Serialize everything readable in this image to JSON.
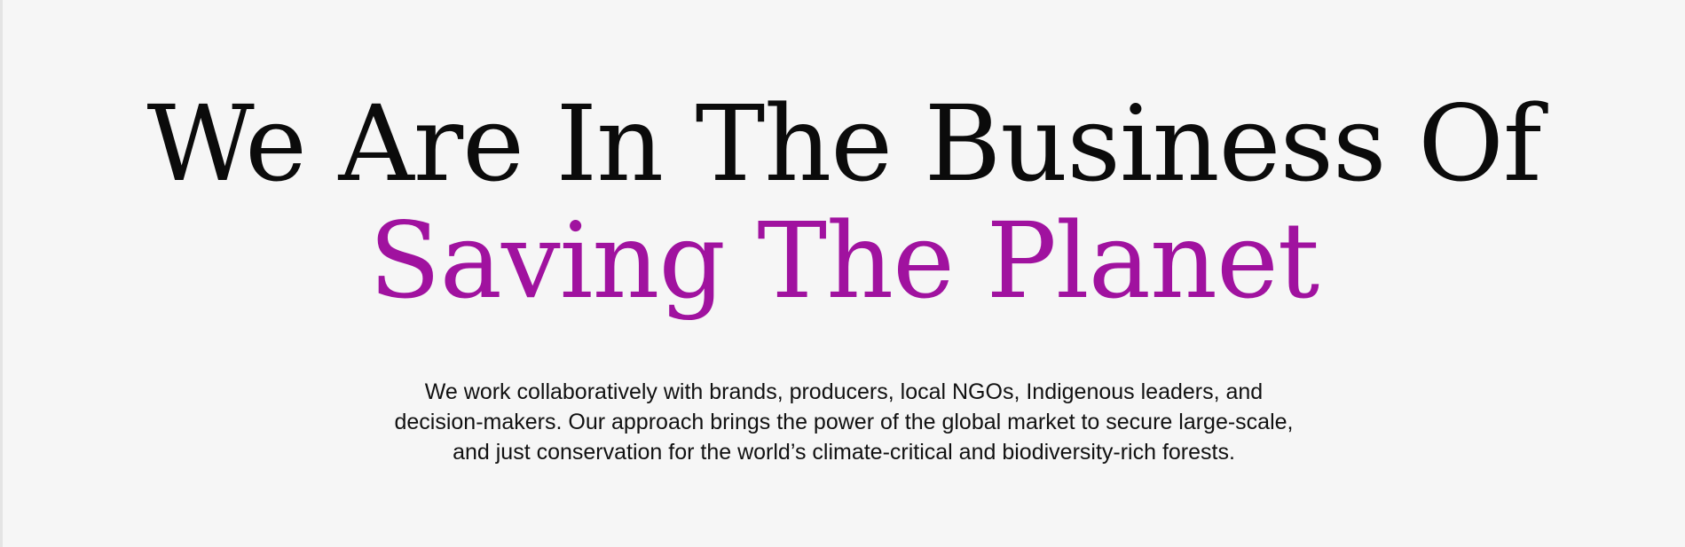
{
  "hero": {
    "headline_line1": "We Are In The Business Of",
    "headline_line2": "Saving The Planet",
    "intro_lines": [
      "We work collaboratively with brands, producers, local NGOs, Indigenous leaders, and",
      "decision-makers. Our approach brings the power of the global market to secure large-scale,",
      "and just conservation for the world’s climate-critical and biodiversity-rich forests."
    ]
  },
  "colors": {
    "background": "#f6f6f6",
    "headline_dark": "#0b0b0b",
    "headline_accent": "#a0129f",
    "body_text": "#111111"
  }
}
